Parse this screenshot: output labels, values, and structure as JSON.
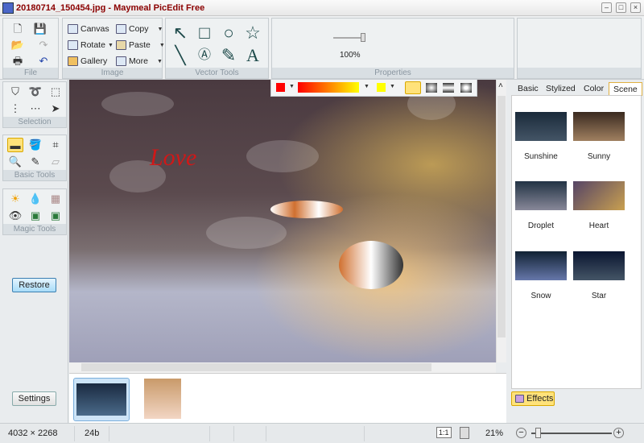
{
  "window": {
    "title": "20180714_150454.jpg - Maymeal PicEdit Free"
  },
  "ribbon": {
    "file": {
      "label": "File"
    },
    "image": {
      "label": "Image",
      "canvas": "Canvas",
      "copy": "Copy",
      "rotate": "Rotate",
      "paste": "Paste",
      "gallery": "Gallery",
      "more": "More"
    },
    "vector": {
      "label": "Vector Tools"
    },
    "properties": {
      "label": "Properties",
      "zoom": "100%"
    }
  },
  "left": {
    "selection": "Selection",
    "basic_tools": "Basic Tools",
    "magic_tools": "Magic Tools",
    "restore": "Restore",
    "settings": "Settings"
  },
  "prop_toolbar": {
    "color1": "#ff0000",
    "color2": "#ffff00"
  },
  "right": {
    "tabs": [
      "Basic",
      "Stylized",
      "Color",
      "Scene"
    ],
    "active_tab": "Scene",
    "effects": [
      "Sunshine",
      "Sunny",
      "Droplet",
      "Heart",
      "Snow",
      "Star"
    ],
    "effects_button": "Effects"
  },
  "status": {
    "dimensions": "4032 × 2268",
    "depth": "24b",
    "zoom": "21%",
    "actual_size": "1:1"
  }
}
